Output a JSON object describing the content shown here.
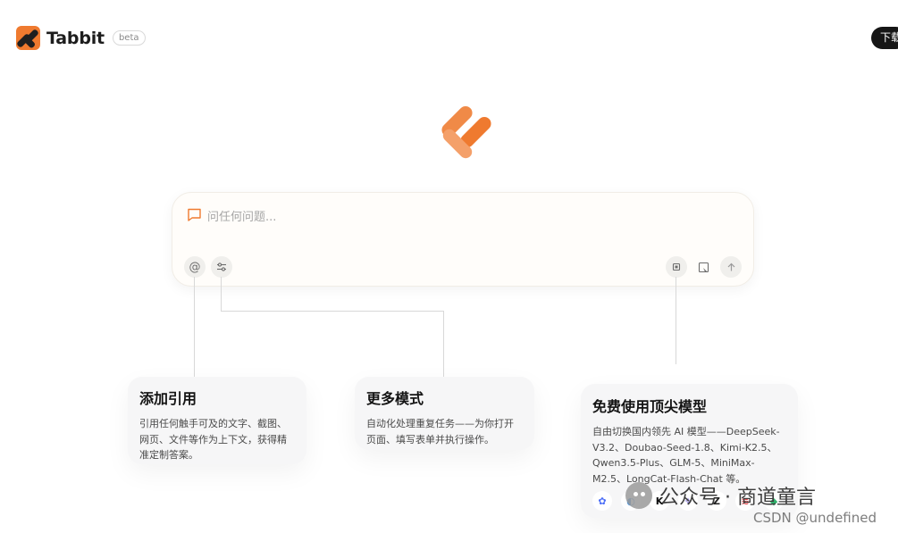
{
  "header": {
    "brand_name": "Tabbit",
    "badge": "beta",
    "download_label": "下载"
  },
  "input": {
    "placeholder": "问任何问题..."
  },
  "features": [
    {
      "title": "添加引用",
      "desc": "引用任何触手可及的文字、截图、网页、文件等作为上下文，获得精准定制答案。"
    },
    {
      "title": "更多模式",
      "desc": "自动化处理重复任务——为你打开页面、填写表单并执行操作。"
    },
    {
      "title": "免费使用顶尖模型",
      "desc": "自由切换国内领先 AI 模型——DeepSeek-V3.2、Doubao-Seed-1.8、Kimi-K2.5、Qwen3.5-Plus、GLM-5、MiniMax-M2.5、LongCat-Flash-Chat 等。"
    }
  ],
  "model_icons": [
    {
      "icon": "deepseek-icon",
      "glyph": "✿",
      "color": "#4a6cf7"
    },
    {
      "icon": "doubao-icon",
      "glyph": "◐",
      "color": "#3a8dde"
    },
    {
      "icon": "kimi-icon",
      "glyph": "K",
      "color": "#111111"
    },
    {
      "icon": "qwen-icon",
      "glyph": "✧",
      "color": "#6b5bd6"
    },
    {
      "icon": "glm-icon",
      "glyph": "Z",
      "color": "#1f1f1f"
    },
    {
      "icon": "minimax-icon",
      "glyph": "≋",
      "color": "#e0474c"
    },
    {
      "icon": "longcat-icon",
      "glyph": "◆",
      "color": "#2fb36b"
    }
  ],
  "watermark": {
    "label": "公众号 · 商道童言",
    "csdn": "CSDN @undefined"
  },
  "colors": {
    "accent": "#ef7a2f",
    "accent_light": "#f29a60",
    "dark": "#161616"
  }
}
